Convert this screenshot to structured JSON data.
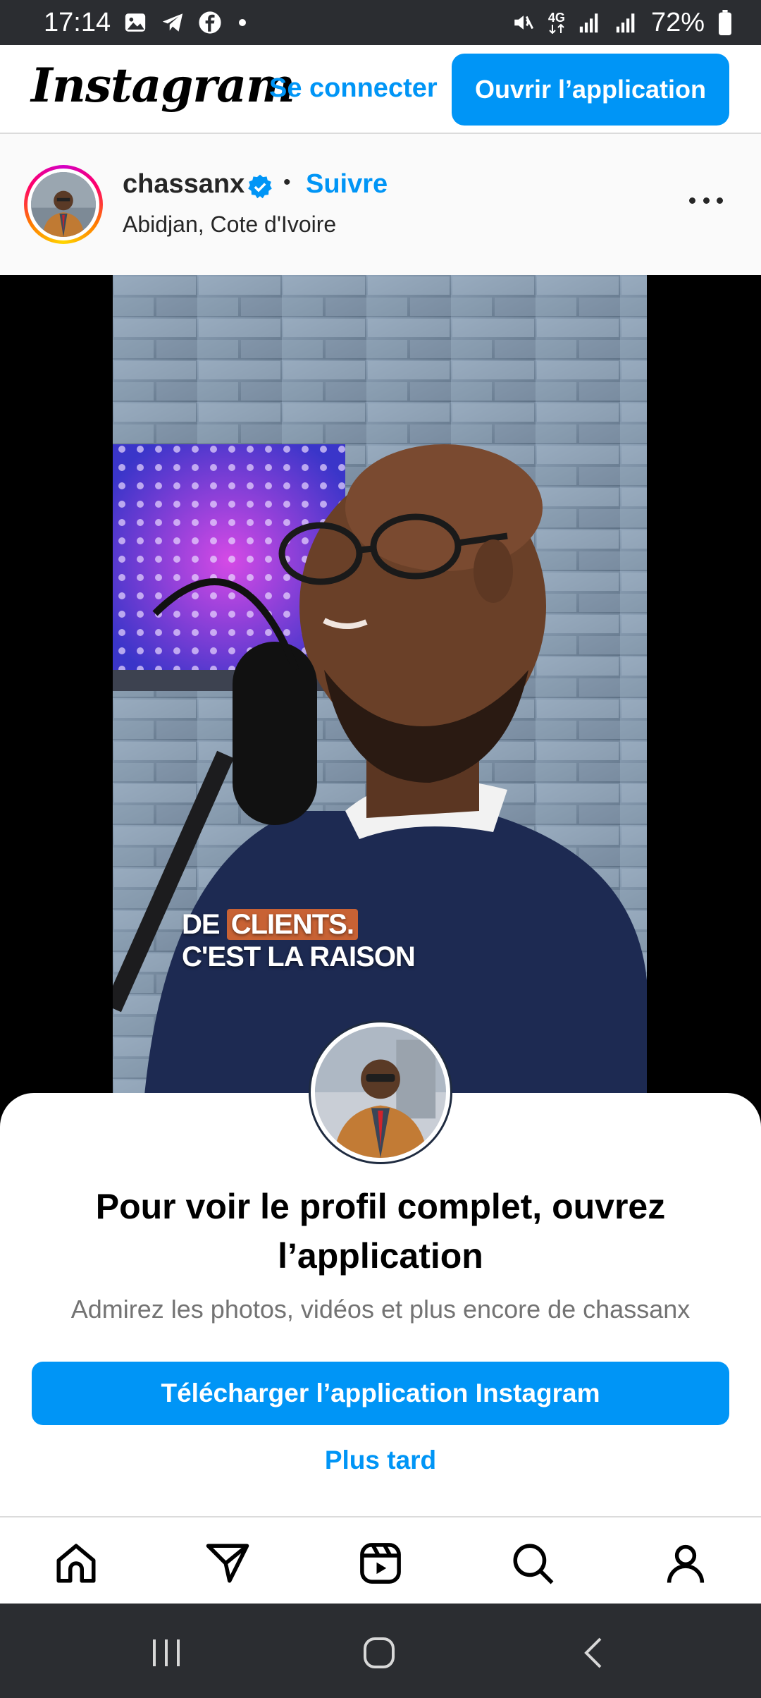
{
  "status_bar": {
    "time": "17:14",
    "network": "4G",
    "battery": "72%",
    "left_icons": [
      "gallery-icon",
      "telegram-icon",
      "facebook-icon",
      "dot-icon"
    ],
    "right_icons": [
      "mute-icon",
      "4g-icon",
      "signal-icon",
      "signal-icon",
      "battery-icon"
    ]
  },
  "header": {
    "logo": "Instagram",
    "login_label": "Se connecter",
    "open_app_label": "Ouvrir l’application"
  },
  "post": {
    "username": "chassanx",
    "verified": true,
    "separator": "•",
    "follow_label": "Suivre",
    "location": "Abidjan, Cote d'Ivoire"
  },
  "video": {
    "caption_line1_prefix": "DE",
    "caption_line1_highlight": "CLIENTS.",
    "caption_line2": "C'EST LA RAISON",
    "highlight_color": "#c86234"
  },
  "sheet": {
    "title": "Pour voir le profil complet, ouvrez l’application",
    "subtitle": "Admirez les photos, vidéos et plus encore de chassanx",
    "download_label": "Télécharger l’application Instagram",
    "later_label": "Plus tard"
  },
  "bottom_nav": {
    "items": [
      "home-icon",
      "direct-send-icon",
      "reels-icon",
      "search-icon",
      "profile-icon"
    ]
  },
  "system_nav": {
    "items": [
      "recent-apps-icon",
      "home-circle-icon",
      "back-icon"
    ]
  },
  "colors": {
    "accent": "#0095f6",
    "status_bar_bg": "#2b2d31",
    "muted_text": "#737373"
  }
}
